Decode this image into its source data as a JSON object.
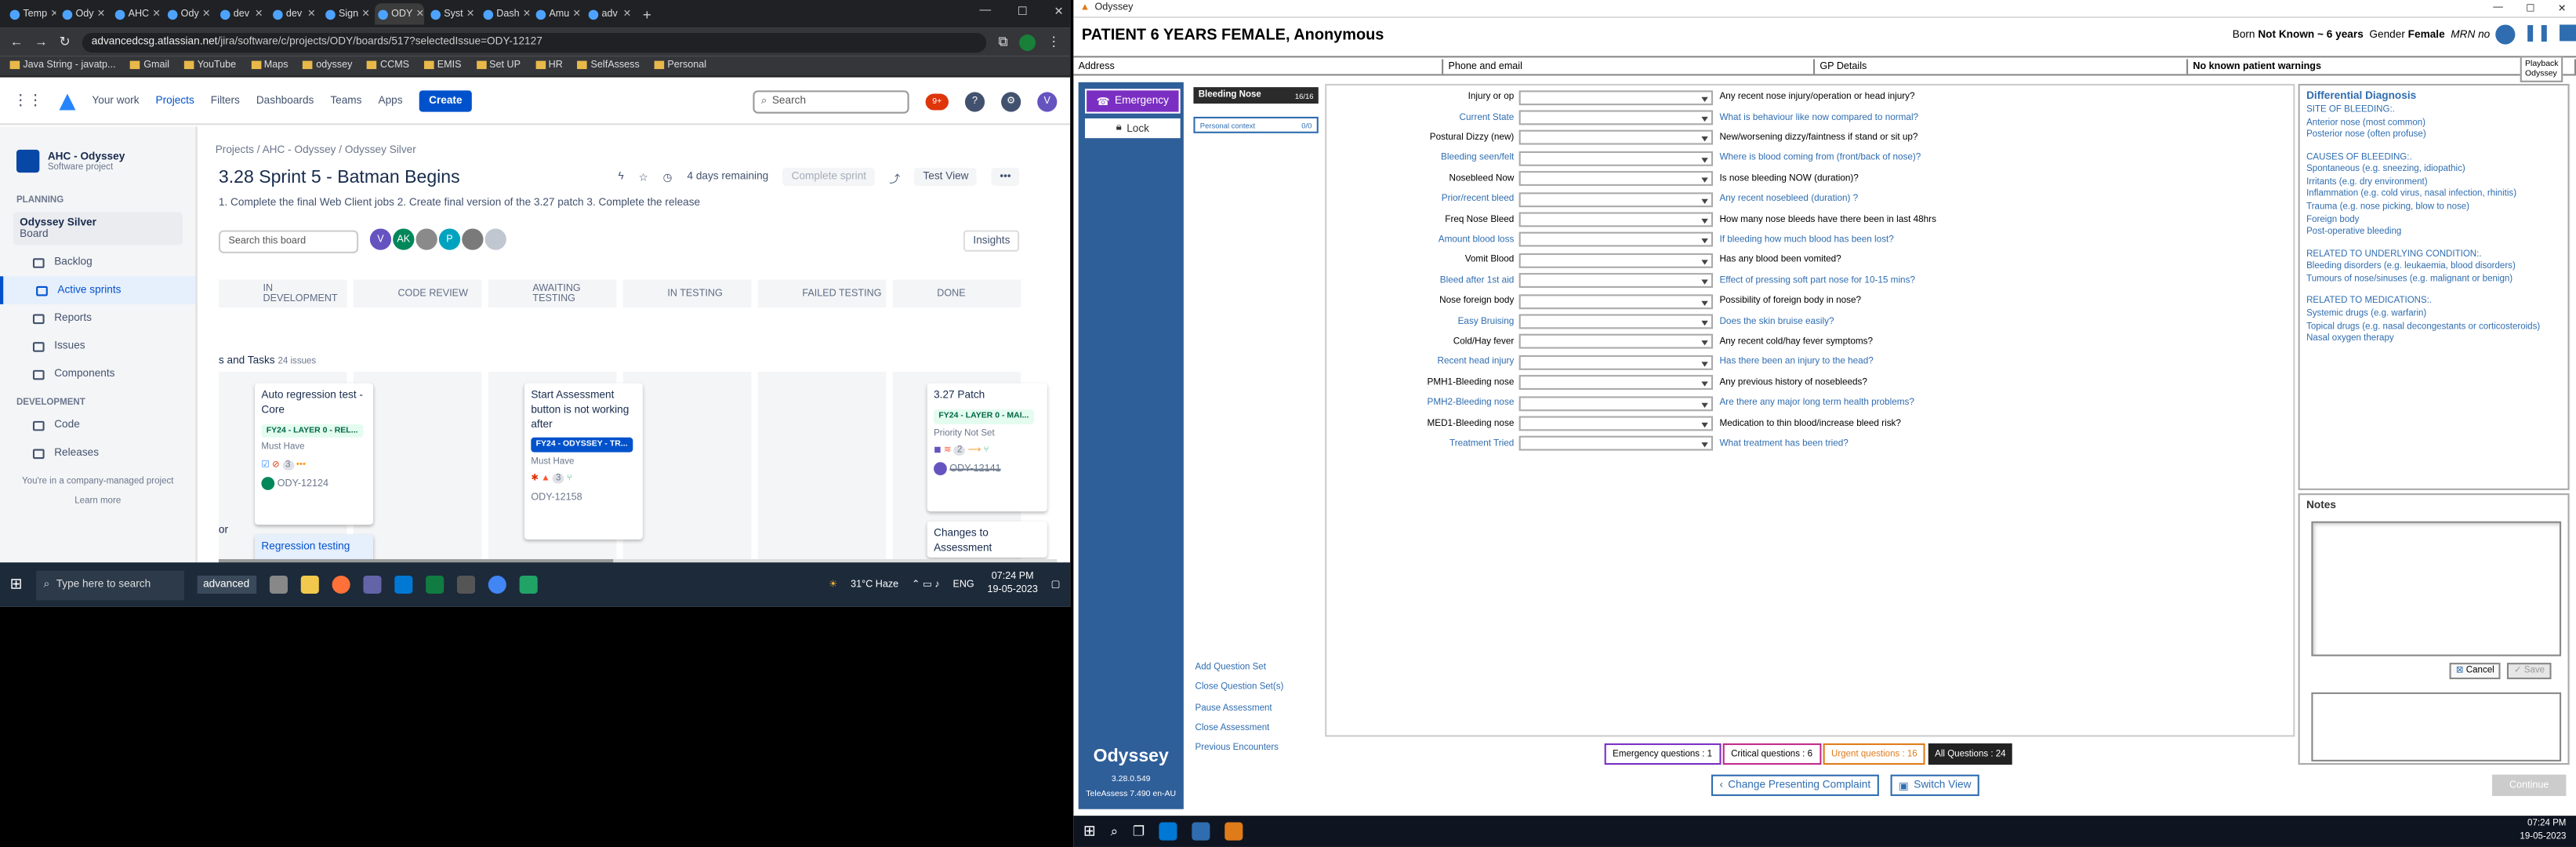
{
  "browser": {
    "tabs": [
      "Temp",
      "Ody",
      "AHC",
      "Ody",
      "dev",
      "dev",
      "Sign",
      "ODY",
      "Syst",
      "Dash",
      "Amu",
      "adv"
    ],
    "url_domain": "advancedcsg.atlassian.net",
    "url_path": "/jira/software/c/projects/ODY/boards/517?selectedIssue=ODY-12127",
    "bookmarks": [
      "Java String - javatp...",
      "Gmail",
      "YouTube",
      "Maps",
      "odyssey",
      "CCMS",
      "EMIS",
      "Set UP",
      "HR",
      "SelfAssess",
      "Personal"
    ]
  },
  "jira": {
    "nav": [
      "Your work",
      "Projects",
      "Filters",
      "Dashboards",
      "Teams",
      "Apps"
    ],
    "create": "Create",
    "search": "Search",
    "notif_count": "9+",
    "project_name": "AHC - Odyssey",
    "project_type": "Software project",
    "planning": "PLANNING",
    "board_name": "Odyssey Silver",
    "board_label": "Board",
    "side_items": [
      "Backlog",
      "Active sprints",
      "Reports",
      "Issues",
      "Components"
    ],
    "development": "DEVELOPMENT",
    "dev_items": [
      "Code",
      "Releases"
    ],
    "managed": "You're in a company-managed project",
    "learn": "Learn more",
    "breadcrumb": [
      "Projects",
      "AHC - Odyssey",
      "Odyssey Silver"
    ],
    "sprint_title": "3.28 Sprint 5 - Batman Begins",
    "days_remaining": "4 days remaining",
    "complete_sprint": "Complete sprint",
    "view": "Test View",
    "goal": "1. Complete the final Web Client jobs 2. Create final version of the 3.27 patch 3. Complete the release",
    "search_board": "Search this board",
    "insights": "Insights",
    "columns": [
      "IN DEVELOPMENT",
      "CODE REVIEW",
      "AWAITING TESTING",
      "IN TESTING",
      "FAILED TESTING",
      "DONE"
    ],
    "stories": "s and Tasks",
    "stories_count": "24 issues",
    "cards": [
      {
        "title": "Auto regression test - Core",
        "label": "FY24 - LAYER 0 - REL...",
        "priority": "Must Have",
        "count": "3",
        "key": "ODY-12124"
      },
      {
        "title": "Start Assessment button is not working after",
        "label": "FY24 - ODYSSEY - TR...",
        "priority": "Must Have",
        "count": "3",
        "key": "ODY-12158"
      },
      {
        "title": "3.27 Patch",
        "label": "FY24 - LAYER 0 - MAI...",
        "priority": "Priority Not Set",
        "count": "2",
        "key": "ODY-12141"
      },
      {
        "title": "Regression testing"
      },
      {
        "title": "Changes to Assessment"
      }
    ],
    "left_label": "or"
  },
  "taskbar1": {
    "search": "Type here to search",
    "app": "advanced",
    "weather": "31°C Haze",
    "lang": "ENG",
    "time": "07:24 PM",
    "date": "19-05-2023"
  },
  "odyssey": {
    "window_title": "Odyssey",
    "patient_title": "PATIENT 6 YEARS FEMALE, Anonymous",
    "born_label": "Born",
    "born_value": "Not Known ~ 6 years",
    "gender_label": "Gender",
    "gender_value": "Female",
    "mrn": "MRN no",
    "playback": "Playback",
    "playback2": "Odyssey",
    "address": "Address",
    "phone": "Phone and email",
    "gp": "GP Details",
    "allergies": "No known patient warnings",
    "emergency": "Emergency",
    "lock": "Lock",
    "qsets": [
      {
        "name": "Bleeding Nose",
        "count": "16/16"
      },
      {
        "name": "Personal context",
        "count": "0/0"
      }
    ],
    "questions": [
      {
        "label": "Injury or op",
        "text": "Any recent nose injury/operation or head injury?",
        "blue": false
      },
      {
        "label": "Current State",
        "text": "What is behaviour like now compared to normal?",
        "blue": true
      },
      {
        "label": "Postural Dizzy (new)",
        "text": "New/worsening dizzy/faintness if stand or sit up?",
        "blue": false
      },
      {
        "label": "Bleeding seen/felt",
        "text": "Where is blood coming from (front/back of nose)?",
        "blue": true
      },
      {
        "label": "Nosebleed Now",
        "text": "Is nose bleeding NOW (duration)?",
        "blue": false
      },
      {
        "label": "Prior/recent bleed",
        "text": "Any recent nosebleed (duration) ?",
        "blue": true
      },
      {
        "label": "Freq Nose Bleed",
        "text": "How many nose bleeds have there been in last 48hrs",
        "blue": false
      },
      {
        "label": "Amount blood loss",
        "text": "If bleeding how much blood has been lost?",
        "blue": true
      },
      {
        "label": "Vomit Blood",
        "text": "Has any blood been vomited?",
        "blue": false
      },
      {
        "label": "Bleed after 1st aid",
        "text": "Effect of pressing soft part nose for 10-15 mins?",
        "blue": true
      },
      {
        "label": "Nose foreign body",
        "text": "Possibility of foreign body in nose?",
        "blue": false
      },
      {
        "label": "Easy Bruising",
        "text": "Does the skin bruise easily?",
        "blue": true
      },
      {
        "label": "Cold/Hay fever",
        "text": "Any recent cold/hay fever symptoms?",
        "blue": false
      },
      {
        "label": "Recent head injury",
        "text": "Has there been an injury to the head?",
        "blue": true
      },
      {
        "label": "PMH1-Bleeding nose",
        "text": "Any previous history of nosebleeds?",
        "blue": false
      },
      {
        "label": "PMH2-Bleeding nose",
        "text": "Are there any major long term health problems?",
        "blue": true
      },
      {
        "label": "MED1-Bleeding nose",
        "text": "Medication to thin blood/increase bleed risk?",
        "blue": false
      },
      {
        "label": "Treatment Tried",
        "text": "What treatment has been tried?",
        "blue": true
      }
    ],
    "dd_title": "Differential Diagnosis",
    "dd_lines": [
      "SITE OF BLEEDING:.",
      "Anterior nose (most common)",
      "Posterior nose (often profuse)",
      "",
      "CAUSES OF BLEEDING:.",
      "Spontaneous (e.g. sneezing, idiopathic)",
      "Irritants (e.g. dry environment)",
      "Inflammation (e.g. cold virus, nasal infection, rhinitis)",
      "Trauma (e.g. nose picking, blow to nose)",
      "Foreign body",
      "Post-operative bleeding",
      "",
      "RELATED TO UNDERLYING CONDITION:.",
      "Bleeding disorders (e.g. leukaemia, blood disorders)",
      "Tumours of nose/sinuses (e.g. malignant or benign)",
      "",
      "RELATED TO MEDICATIONS:.",
      "Systemic drugs (e.g. warfarin)",
      "Topical drugs (e.g. nasal decongestants or corticosteroids)",
      "Nasal oxygen therapy"
    ],
    "notes": "Notes",
    "cancel": "Cancel",
    "save": "Save",
    "links": [
      "Add Question Set",
      "Close Question Set(s)",
      "Pause Assessment",
      "Close Assessment",
      "Previous Encounters"
    ],
    "app_name": "Odyssey",
    "version": "3.28.0.549",
    "teleassess": "TeleAssess 7.490 en-AU",
    "counts": {
      "emergency": "Emergency questions : 1",
      "critical": "Critical questions : 6",
      "urgent": "Urgent questions : 16",
      "all": "All Questions : 24"
    },
    "change_complaint": "Change Presenting Complaint",
    "switch_view": "Switch View",
    "continue": "Continue",
    "time": "07:24 PM",
    "date": "19-05-2023",
    "colors": {
      "purple": "#7a2fc2",
      "critical": "#c02a8c",
      "urgent": "#e07b1a",
      "nav": "#2f5f99"
    }
  }
}
